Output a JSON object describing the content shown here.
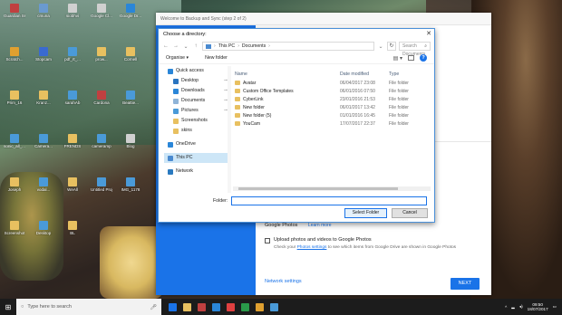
{
  "desktop": {
    "icons": [
      {
        "label": "Guardian Ssssss",
        "color": "#c04040"
      },
      {
        "label": "cmuna",
        "color": "#6a9ad0"
      },
      {
        "label": "siobhvi",
        "color": "#d0d0d0"
      },
      {
        "label": "Google Cl...",
        "color": "#d0d0d0"
      },
      {
        "label": "Google Dr...",
        "color": "#2a86d8"
      },
      {
        "label": "Scratch...",
        "color": "#e0a030"
      },
      {
        "label": "Stopcam",
        "color": "#3a6ad0"
      },
      {
        "label": "pdf_rt_...",
        "color": "#4a9ad8"
      },
      {
        "label": "prow...",
        "color": "#e8c060"
      },
      {
        "label": "Cornell",
        "color": "#e8c060"
      },
      {
        "label": "Prim_16",
        "color": "#e8c060"
      },
      {
        "label": "Kranz...",
        "color": "#e8c060"
      },
      {
        "label": "sarahAb",
        "color": "#4a9ad8"
      },
      {
        "label": "Cardona",
        "color": "#c04040"
      },
      {
        "label": "Beattie...",
        "color": "#4a9ad8"
      },
      {
        "label": "sonic_all_...",
        "color": "#4a9ad8"
      },
      {
        "label": "Camera...",
        "color": "#4a9ad8"
      },
      {
        "label": "FRENDS",
        "color": "#e8c060"
      },
      {
        "label": "cameramp",
        "color": "#4a9ad8"
      },
      {
        "label": "Blog",
        "color": "#d0d0d0"
      },
      {
        "label": "Joseph",
        "color": "#e8c060"
      },
      {
        "label": "vodal...",
        "color": "#4a9ad8"
      },
      {
        "label": "WeAll",
        "color": "#e8c060"
      },
      {
        "label": "Untitled Projects",
        "color": "#4a9ad8"
      },
      {
        "label": "IMG_1178",
        "color": "#4a9ad8"
      },
      {
        "label": "Screenshot",
        "color": "#e8c060"
      },
      {
        "label": "Desktop",
        "color": "#4a9ad8"
      },
      {
        "label": "BL",
        "color": "#e8c060"
      }
    ]
  },
  "backup_window": {
    "title": "Welcome to Backup and Sync (step 2 of 2)",
    "google_photos_label": "Google Photos",
    "learn_more": "Learn more",
    "upload_label": "Upload photos and videos to Google Photos",
    "sub_text_prefix": "Check your ",
    "sub_text_link": "Photos settings",
    "sub_text_suffix": " to see which items from Google Drive are shown in Google Photos",
    "network_settings": "Network settings",
    "next_label": "NEXT",
    "accent_color": "#1a73e8"
  },
  "dialog": {
    "title": "Choose a directory:",
    "close_glyph": "✕",
    "address": {
      "crumbs": [
        "This PC",
        "Documents"
      ],
      "separator": "›"
    },
    "search_placeholder": "Search Documents",
    "toolbar": {
      "organise": "Organise ▾",
      "new_folder": "New folder",
      "help": "?"
    },
    "nav": [
      {
        "label": "Quick access",
        "icon": "star-icon"
      },
      {
        "label": "Desktop",
        "icon": "desktop-icon",
        "pinned": true
      },
      {
        "label": "Downloads",
        "icon": "download-icon",
        "pinned": true
      },
      {
        "label": "Documents",
        "icon": "documents-icon",
        "pinned": true
      },
      {
        "label": "Pictures",
        "icon": "pictures-icon",
        "pinned": true
      },
      {
        "label": "Screenshots",
        "icon": "folder-icon"
      },
      {
        "label": "skins",
        "icon": "folder-icon"
      },
      {
        "label": "OneDrive",
        "icon": "cloud-icon"
      },
      {
        "label": "This PC",
        "icon": "pc-icon",
        "selected": true
      },
      {
        "label": "Network",
        "icon": "network-icon"
      }
    ],
    "columns": {
      "name": "Name",
      "date": "Date modified",
      "type": "Type"
    },
    "files": [
      {
        "name": "Avatar",
        "date": "06/04/2017 23:08",
        "type": "File folder"
      },
      {
        "name": "Custom Office Templates",
        "date": "06/01/2016 07:50",
        "type": "File folder"
      },
      {
        "name": "CyberLink",
        "date": "23/01/2016 21:53",
        "type": "File folder"
      },
      {
        "name": "New folder",
        "date": "06/01/2017 13:42",
        "type": "File folder"
      },
      {
        "name": "New folder (5)",
        "date": "01/01/2016 16:45",
        "type": "File folder"
      },
      {
        "name": "YouCam",
        "date": "17/07/2017 22:37",
        "type": "File folder"
      }
    ],
    "folder_label": "Folder:",
    "folder_value": "",
    "select_button": "Select Folder",
    "cancel_button": "Cancel"
  },
  "taskbar": {
    "search_placeholder": "Type here to search",
    "apps": [
      "#1a73e8",
      "#e8c060",
      "#c04040",
      "#2a86d8",
      "#e04040",
      "#2a9a4a",
      "#e0a030",
      "#4a9ad8"
    ],
    "time": "09:50",
    "date": "18/07/2017"
  }
}
